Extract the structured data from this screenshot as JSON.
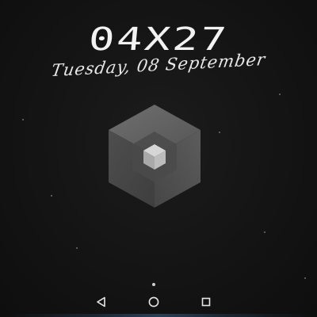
{
  "lockscreen": {
    "time": "04X27",
    "date": "Tuesday, 08 September"
  },
  "wallpaper": {
    "motif": "hexagonal-cube",
    "colors": {
      "background": "#111111",
      "cube_light": "#6a6a6a",
      "cube_dark": "#3a3a3a",
      "inner_cube": "#bdbdbd"
    }
  },
  "pager": {
    "current_page": 1
  },
  "navigation": {
    "back_icon": "triangle-left",
    "home_icon": "circle",
    "recents_icon": "square"
  }
}
